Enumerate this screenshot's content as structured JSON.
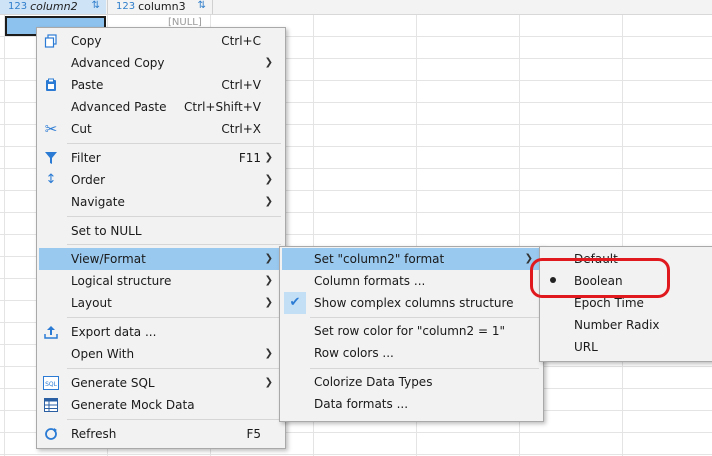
{
  "grid": {
    "columns": [
      {
        "type_label": "123",
        "name": "column2",
        "sort_icon": "sort-filter-icon"
      },
      {
        "type_label": "123",
        "name": "column3",
        "sort_icon": "sort-filter-icon"
      }
    ],
    "null_value": "[NULL]"
  },
  "menu": {
    "copy": {
      "label": "Copy",
      "shortcut": "Ctrl+C",
      "icon": "copy-icon"
    },
    "advanced_copy": {
      "label": "Advanced Copy"
    },
    "paste": {
      "label": "Paste",
      "shortcut": "Ctrl+V",
      "icon": "paste-icon"
    },
    "advanced_paste": {
      "label": "Advanced Paste",
      "shortcut": "Ctrl+Shift+V"
    },
    "cut": {
      "label": "Cut",
      "shortcut": "Ctrl+X",
      "icon": "scissors-icon"
    },
    "filter": {
      "label": "Filter",
      "shortcut": "F11",
      "icon": "filter-icon"
    },
    "order": {
      "label": "Order",
      "icon": "sort-icon"
    },
    "navigate": {
      "label": "Navigate"
    },
    "set_null": {
      "label": "Set to NULL"
    },
    "view_format": {
      "label": "View/Format"
    },
    "logical_structure": {
      "label": "Logical structure"
    },
    "layout": {
      "label": "Layout"
    },
    "export_data": {
      "label": "Export data ...",
      "icon": "export-icon"
    },
    "open_with": {
      "label": "Open With"
    },
    "generate_sql": {
      "label": "Generate SQL",
      "icon": "sql-icon"
    },
    "generate_mock": {
      "label": "Generate Mock Data",
      "icon": "table-icon"
    },
    "refresh": {
      "label": "Refresh",
      "shortcut": "F5",
      "icon": "refresh-icon"
    }
  },
  "submenu_view_format": {
    "set_format": {
      "label": "Set \"column2\" format"
    },
    "column_formats": {
      "label": "Column formats ..."
    },
    "show_complex": {
      "label": "Show complex columns structure",
      "checked": true
    },
    "set_row_color": {
      "label": "Set row color for \"column2 = 1\""
    },
    "row_colors": {
      "label": "Row colors ..."
    },
    "colorize": {
      "label": "Colorize Data Types"
    },
    "data_formats": {
      "label": "Data formats ..."
    }
  },
  "submenu_format": {
    "default": {
      "label": "Default"
    },
    "boolean": {
      "label": "Boolean",
      "selected": true
    },
    "epoch_time": {
      "label": "Epoch Time"
    },
    "number_radix": {
      "label": "Number Radix"
    },
    "url": {
      "label": "URL"
    }
  },
  "colors": {
    "highlight": "#99c9ef",
    "menu_bg": "#f2f2f2",
    "annotation": "#e0191f",
    "accent": "#2b7bd4"
  }
}
